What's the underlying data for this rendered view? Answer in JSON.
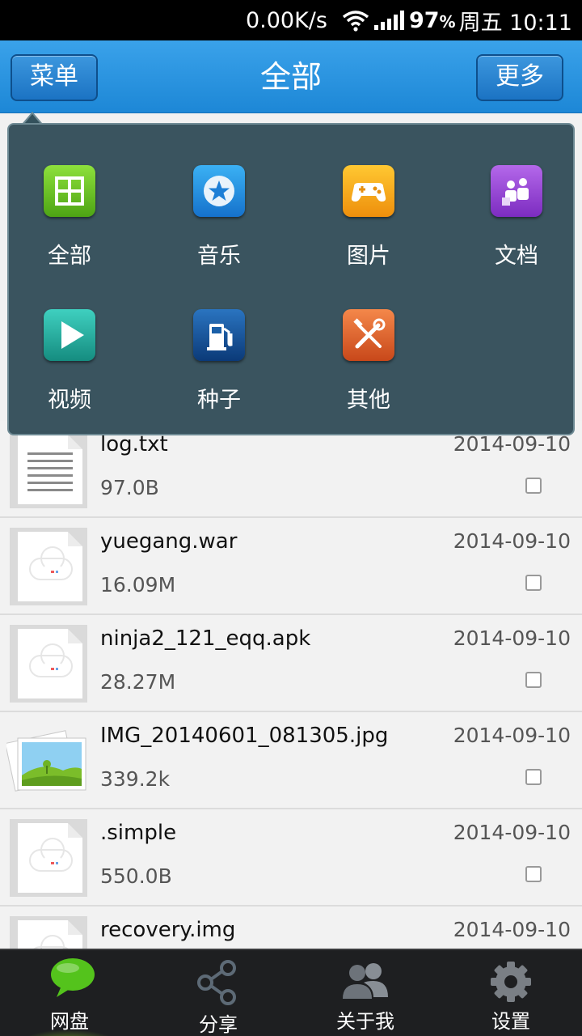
{
  "status_bar": {
    "speed": "0.00K/s",
    "battery": "97",
    "battery_unit": "%",
    "day_time": "周五 10:11"
  },
  "title_bar": {
    "menu_label": "菜单",
    "title": "全部",
    "more_label": "更多"
  },
  "menu_popup": {
    "items": [
      {
        "label": "全部",
        "icon": "grid-icon",
        "color": "#5dbb1c"
      },
      {
        "label": "音乐",
        "icon": "star-icon",
        "color": "#1f8fe0"
      },
      {
        "label": "图片",
        "icon": "gamepad-icon",
        "color": "#f2a417"
      },
      {
        "label": "文档",
        "icon": "people-icon",
        "color": "#9a48d6"
      },
      {
        "label": "视频",
        "icon": "play-icon",
        "color": "#1aa79a"
      },
      {
        "label": "种子",
        "icon": "fuel-icon",
        "color": "#1a5fa8"
      },
      {
        "label": "其他",
        "icon": "tools-icon",
        "color": "#e06322"
      }
    ]
  },
  "files": [
    {
      "name": "log.txt",
      "size": "97.0B",
      "date": "2014-09-10",
      "type": "text"
    },
    {
      "name": "yuegang.war",
      "size": "16.09M",
      "date": "2014-09-10",
      "type": "generic"
    },
    {
      "name": "ninja2_121_eqq.apk",
      "size": "28.27M",
      "date": "2014-09-10",
      "type": "generic"
    },
    {
      "name": "IMG_20140601_081305.jpg",
      "size": "339.2k",
      "date": "2014-09-10",
      "type": "image"
    },
    {
      "name": ".simple",
      "size": "550.0B",
      "date": "2014-09-10",
      "type": "generic"
    },
    {
      "name": "recovery.img",
      "size": "",
      "date": "2014-09-10",
      "type": "generic"
    }
  ],
  "bottom_nav": {
    "tabs": [
      {
        "label": "网盘",
        "icon": "chat-bubble-icon"
      },
      {
        "label": "分享",
        "icon": "share-icon"
      },
      {
        "label": "关于我",
        "icon": "users-icon"
      },
      {
        "label": "设置",
        "icon": "gear-icon"
      }
    ]
  },
  "colors": {
    "title_bar": "#2796e0",
    "popup_bg": "#2c4854",
    "active_tab": "#4db81e"
  }
}
